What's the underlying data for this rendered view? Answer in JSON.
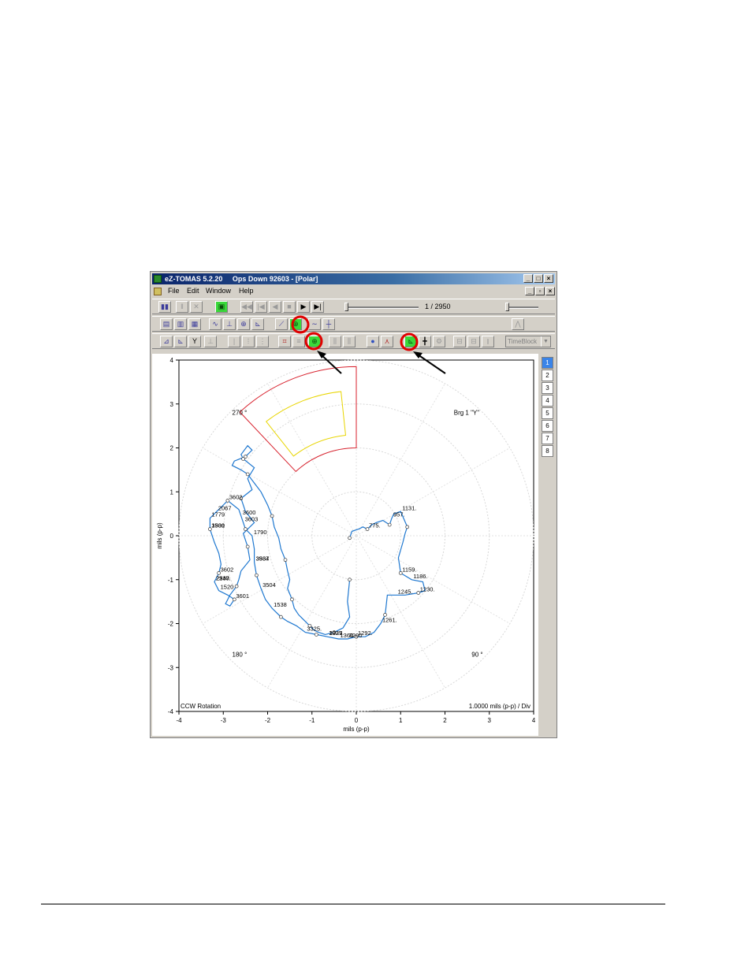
{
  "window": {
    "app_title": "eZ-TOMAS 5.2.20",
    "doc_title": "Ops Down 92603 - [Polar]",
    "minimize": "_",
    "maximize": "□",
    "close": "×",
    "restore": "▫"
  },
  "menu": {
    "file": "File",
    "edit": "Edit",
    "window": "Window",
    "help": "Help"
  },
  "playback": {
    "position": "1 / 2950"
  },
  "toolbar": {
    "timeblock": "TimeBlock"
  },
  "page_tabs": [
    "1",
    "2",
    "3",
    "4",
    "5",
    "6",
    "7",
    "8"
  ],
  "plot": {
    "xlabel": "mils (p-p)",
    "ylabel": "mils (p-p)",
    "x_ticks": [
      "-4",
      "-3",
      "-2",
      "-1",
      "0",
      "1",
      "2",
      "3",
      "4"
    ],
    "y_ticks": [
      "4",
      "3",
      "2",
      "1",
      "0",
      "-1",
      "-2",
      "-3",
      "-4"
    ],
    "angle_labels": {
      "a270": "270 °",
      "a180": "180 °",
      "a90": "90 °"
    },
    "probe_label": "Brg 1 \"Y\"",
    "rotation": "CCW Rotation",
    "scale": "1.0000 mils (p-p) / Div"
  },
  "chart_data": {
    "type": "scatter",
    "xlabel": "mils (p-p)",
    "ylabel": "mils (p-p)",
    "xlim": [
      -4,
      4
    ],
    "ylim": [
      -4,
      4
    ],
    "grid": "polar",
    "series": [
      {
        "x": [
          -0.15,
          -0.1,
          0.05,
          0.15,
          0.25,
          0.35,
          0.45,
          0.6,
          0.75,
          0.8,
          0.85,
          1.0,
          1.15,
          1.1,
          1.05,
          0.95,
          1.0,
          1.25,
          1.5,
          1.55,
          1.4,
          1.1,
          0.9,
          0.7,
          0.65,
          0.55,
          0.4,
          0.2,
          0.0,
          -0.2,
          -0.4,
          -0.65,
          -0.9,
          -1.15,
          -1.35,
          -1.55,
          -1.7,
          -1.9,
          -2.05,
          -2.15,
          -2.25,
          -2.3,
          -2.3,
          -2.35,
          -2.5,
          -2.55,
          -2.6,
          -2.65,
          -2.9,
          -3.0,
          -3.15,
          -3.3,
          -3.3,
          -3.2,
          -3.1,
          -3.05,
          -3.1,
          -3.2,
          -3.1,
          -2.9,
          -2.75,
          -2.85,
          -2.95,
          -2.85,
          -2.7,
          -2.65,
          -2.6,
          -2.4,
          -2.45,
          -2.55,
          -2.3,
          -2.5,
          -2.6,
          -2.35,
          -2.45,
          -2.3,
          -2.55,
          -2.6,
          -2.45,
          -2.35,
          -2.5,
          -2.75,
          -2.8,
          -2.6,
          -2.45,
          -2.3,
          -2.15,
          -2.0,
          -1.9,
          -1.85,
          -1.75,
          -1.7,
          -1.6,
          -1.55,
          -1.5,
          -1.55,
          -1.45,
          -1.4,
          -1.3,
          -1.15,
          -1.05,
          -0.95,
          -0.85,
          -0.7,
          -0.5,
          -0.3,
          -0.15,
          -0.2,
          -0.15
        ],
        "y": [
          -0.05,
          0.1,
          0.15,
          0.2,
          0.15,
          0.25,
          0.3,
          0.35,
          0.25,
          0.4,
          0.5,
          0.55,
          0.2,
          0.05,
          -0.15,
          -0.5,
          -0.85,
          -1.0,
          -1.05,
          -1.25,
          -1.3,
          -1.35,
          -1.35,
          -1.35,
          -1.8,
          -2.0,
          -2.2,
          -2.3,
          -2.3,
          -2.35,
          -2.35,
          -2.3,
          -2.25,
          -2.2,
          -2.05,
          -1.95,
          -1.85,
          -1.65,
          -1.45,
          -1.2,
          -0.9,
          -0.6,
          -0.3,
          0.0,
          0.15,
          0.3,
          0.45,
          0.6,
          0.8,
          0.7,
          0.55,
          0.4,
          0.15,
          -0.15,
          -0.4,
          -0.65,
          -0.85,
          -1.05,
          -1.25,
          -1.35,
          -1.45,
          -1.6,
          -1.55,
          -1.35,
          -1.15,
          -1.0,
          -0.8,
          -0.55,
          -0.25,
          0.05,
          0.3,
          0.55,
          0.85,
          1.05,
          1.3,
          1.55,
          1.75,
          1.85,
          2.05,
          1.95,
          1.8,
          1.7,
          1.6,
          1.5,
          1.4,
          1.2,
          1.0,
          0.7,
          0.45,
          0.2,
          -0.05,
          -0.3,
          -0.55,
          -0.8,
          -1.0,
          -1.2,
          -1.45,
          -1.65,
          -1.8,
          -1.95,
          -2.05,
          -2.15,
          -2.2,
          -2.25,
          -2.2,
          -2.1,
          -1.85,
          -1.5,
          -1.0
        ]
      }
    ],
    "annotations": [
      "775.",
      "957.",
      "1131.",
      "1159.",
      "1186.",
      "1230.",
      "1245.",
      "1261.",
      "1292.",
      "3200",
      "1360",
      "3037.",
      "1329",
      "3325.",
      "1538",
      "3937",
      "3584",
      "3504",
      "1790",
      "3603",
      "3600",
      "3602",
      "2067",
      "1779",
      "1930",
      "3501",
      "3602",
      "1520",
      "3601",
      "2240.",
      "2330.",
      "2547."
    ],
    "probe_label": "Brg 1 \"Y\"",
    "zones": [
      {
        "color": "#d8222e",
        "r": [
          2.0,
          3.85
        ],
        "angle_deg": [
          227,
          270
        ]
      },
      {
        "color": "#e8d500",
        "r": [
          2.3,
          3.3
        ],
        "angle_deg": [
          232,
          264
        ]
      }
    ]
  }
}
